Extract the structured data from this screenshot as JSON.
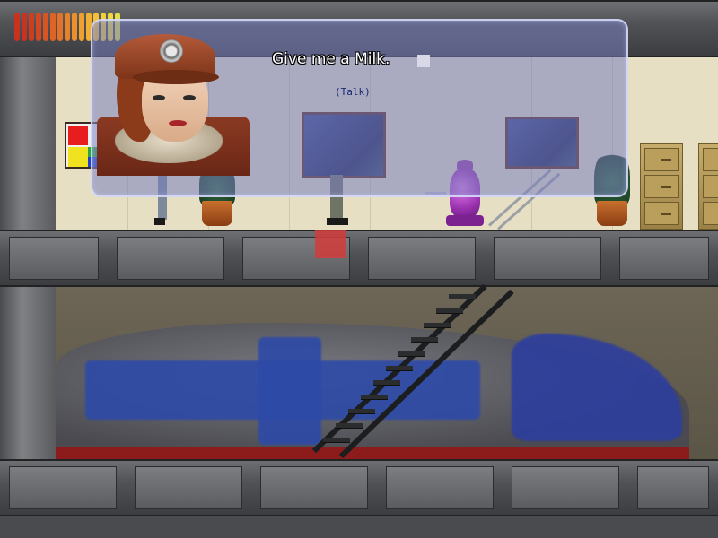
{
  "dialog": {
    "text": "Give me a Milk.",
    "subtext": "(Talk)"
  },
  "portrait": {
    "icon": "character-portrait"
  },
  "hud": {
    "health_icon": "health-bar",
    "health_colors": [
      "#c8321e",
      "#c8321e",
      "#cf3d1f",
      "#d34820",
      "#d85522",
      "#de6324",
      "#e37226",
      "#e88228",
      "#ec902b",
      "#f0a02e",
      "#f2b032",
      "#f3c037",
      "#f2ce3c",
      "#eed942",
      "#e4df48"
    ]
  },
  "scene": {
    "palette": {
      "wall": "#e7dfc4",
      "floor": "#5a5c60",
      "dialog_border": "#dce1ff",
      "marker": "#d23b3b"
    },
    "objects": [
      "painting",
      "painting",
      "flower-pot",
      "flower-pot",
      "coffee-urn",
      "filing-cabinet",
      "filing-cabinet",
      "staircase",
      "train",
      "color-panel"
    ]
  }
}
